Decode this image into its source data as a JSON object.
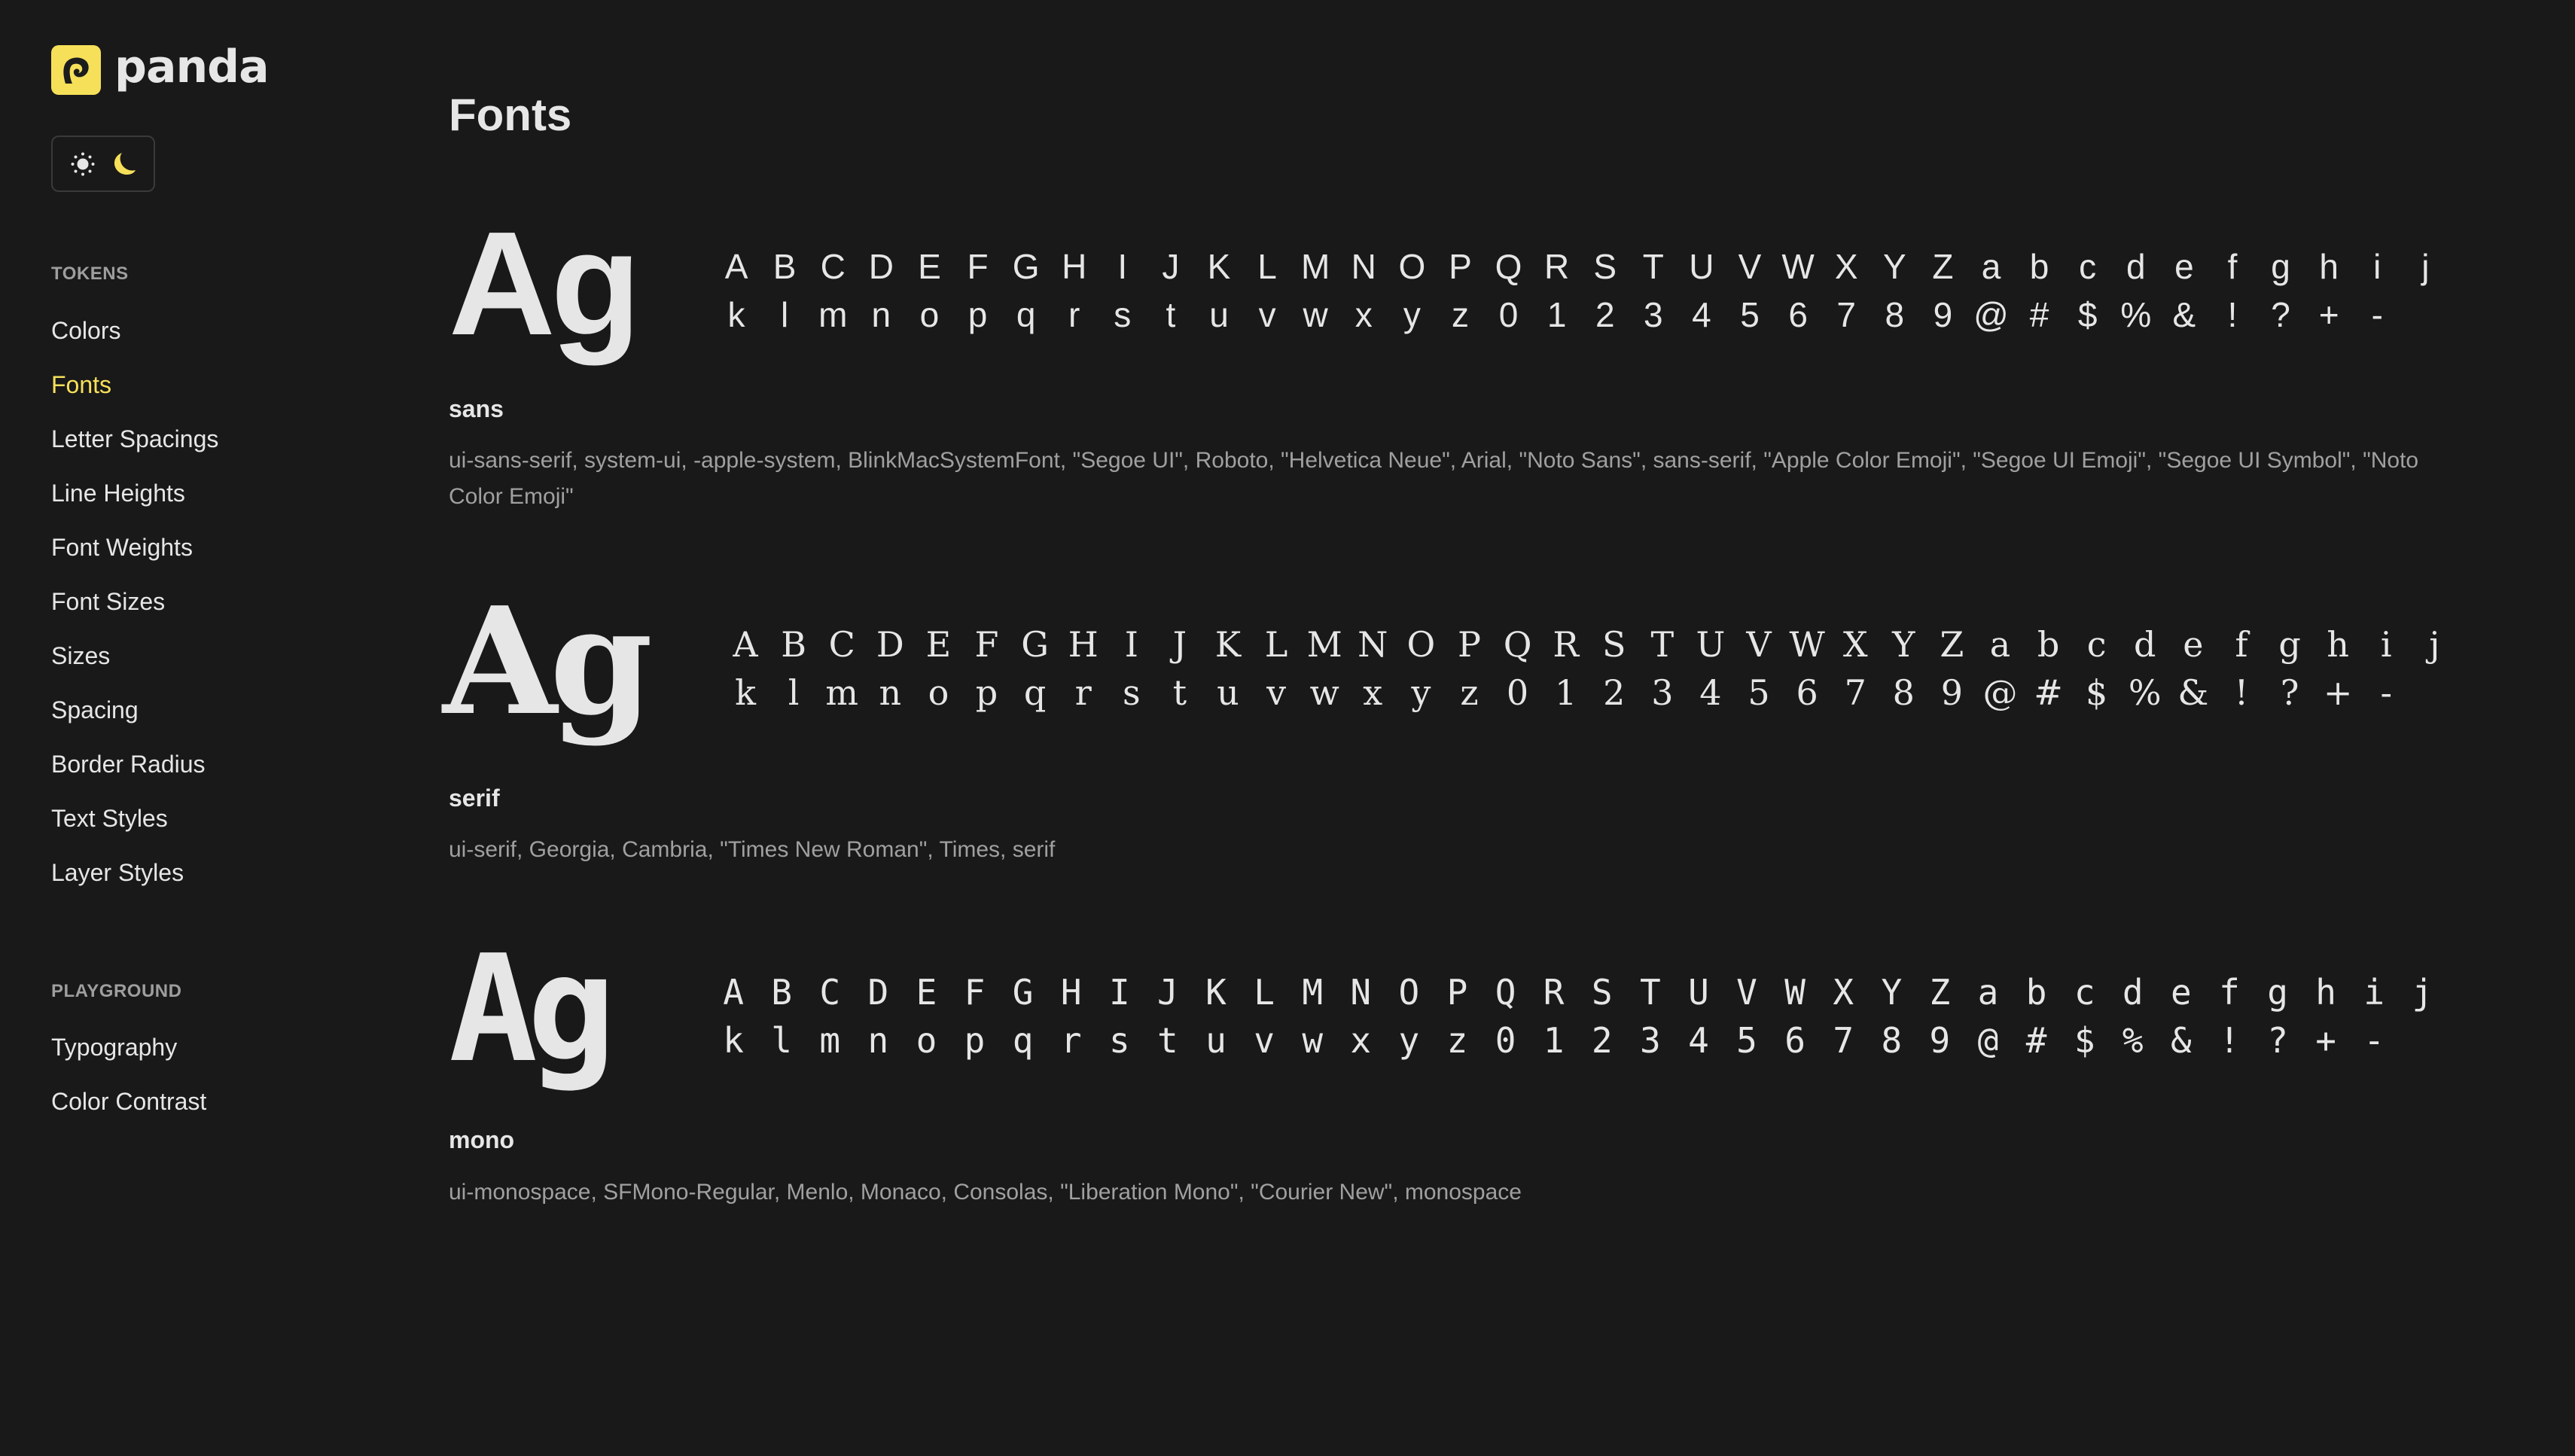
{
  "brand": {
    "name": "panda",
    "accent_color": "#f6e05a",
    "logo_icon": "panda-logo-icon"
  },
  "theme_toggle": {
    "light_icon": "sun-icon",
    "dark_icon": "moon-icon",
    "active": "dark"
  },
  "sidebar": {
    "sections": [
      {
        "title": "TOKENS",
        "items": [
          {
            "label": "Colors",
            "active": false
          },
          {
            "label": "Fonts",
            "active": true
          },
          {
            "label": "Letter Spacings",
            "active": false
          },
          {
            "label": "Line Heights",
            "active": false
          },
          {
            "label": "Font Weights",
            "active": false
          },
          {
            "label": "Font Sizes",
            "active": false
          },
          {
            "label": "Sizes",
            "active": false
          },
          {
            "label": "Spacing",
            "active": false
          },
          {
            "label": "Border Radius",
            "active": false
          },
          {
            "label": "Text Styles",
            "active": false
          },
          {
            "label": "Layer Styles",
            "active": false
          }
        ]
      },
      {
        "title": "PLAYGROUND",
        "items": [
          {
            "label": "Typography",
            "active": false
          },
          {
            "label": "Color Contrast",
            "active": false
          }
        ]
      }
    ]
  },
  "main": {
    "title": "Fonts",
    "sample_text": "Ag",
    "glyphs": [
      "A",
      "B",
      "C",
      "D",
      "E",
      "F",
      "G",
      "H",
      "I",
      "J",
      "K",
      "L",
      "M",
      "N",
      "O",
      "P",
      "Q",
      "R",
      "S",
      "T",
      "U",
      "V",
      "W",
      "X",
      "Y",
      "Z",
      "a",
      "b",
      "c",
      "d",
      "e",
      "f",
      "g",
      "h",
      "i",
      "j",
      "k",
      "l",
      "m",
      "n",
      "o",
      "p",
      "q",
      "r",
      "s",
      "t",
      "u",
      "v",
      "w",
      "x",
      "y",
      "z",
      "0",
      "1",
      "2",
      "3",
      "4",
      "5",
      "6",
      "7",
      "8",
      "9",
      "@",
      "#",
      "$",
      "%",
      "&",
      "!",
      "?",
      "+",
      "-"
    ],
    "fonts": [
      {
        "name": "sans",
        "stack": "ui-sans-serif, system-ui, -apple-system, BlinkMacSystemFont, \"Segoe UI\", Roboto, \"Helvetica Neue\", Arial, \"Noto Sans\", sans-serif, \"Apple Color Emoji\", \"Segoe UI Emoji\", \"Segoe UI Symbol\", \"Noto Color Emoji\""
      },
      {
        "name": "serif",
        "stack": "ui-serif, Georgia, Cambria, \"Times New Roman\", Times, serif"
      },
      {
        "name": "mono",
        "stack": "ui-monospace, SFMono-Regular, Menlo, Monaco, Consolas, \"Liberation Mono\", \"Courier New\", monospace"
      }
    ]
  }
}
